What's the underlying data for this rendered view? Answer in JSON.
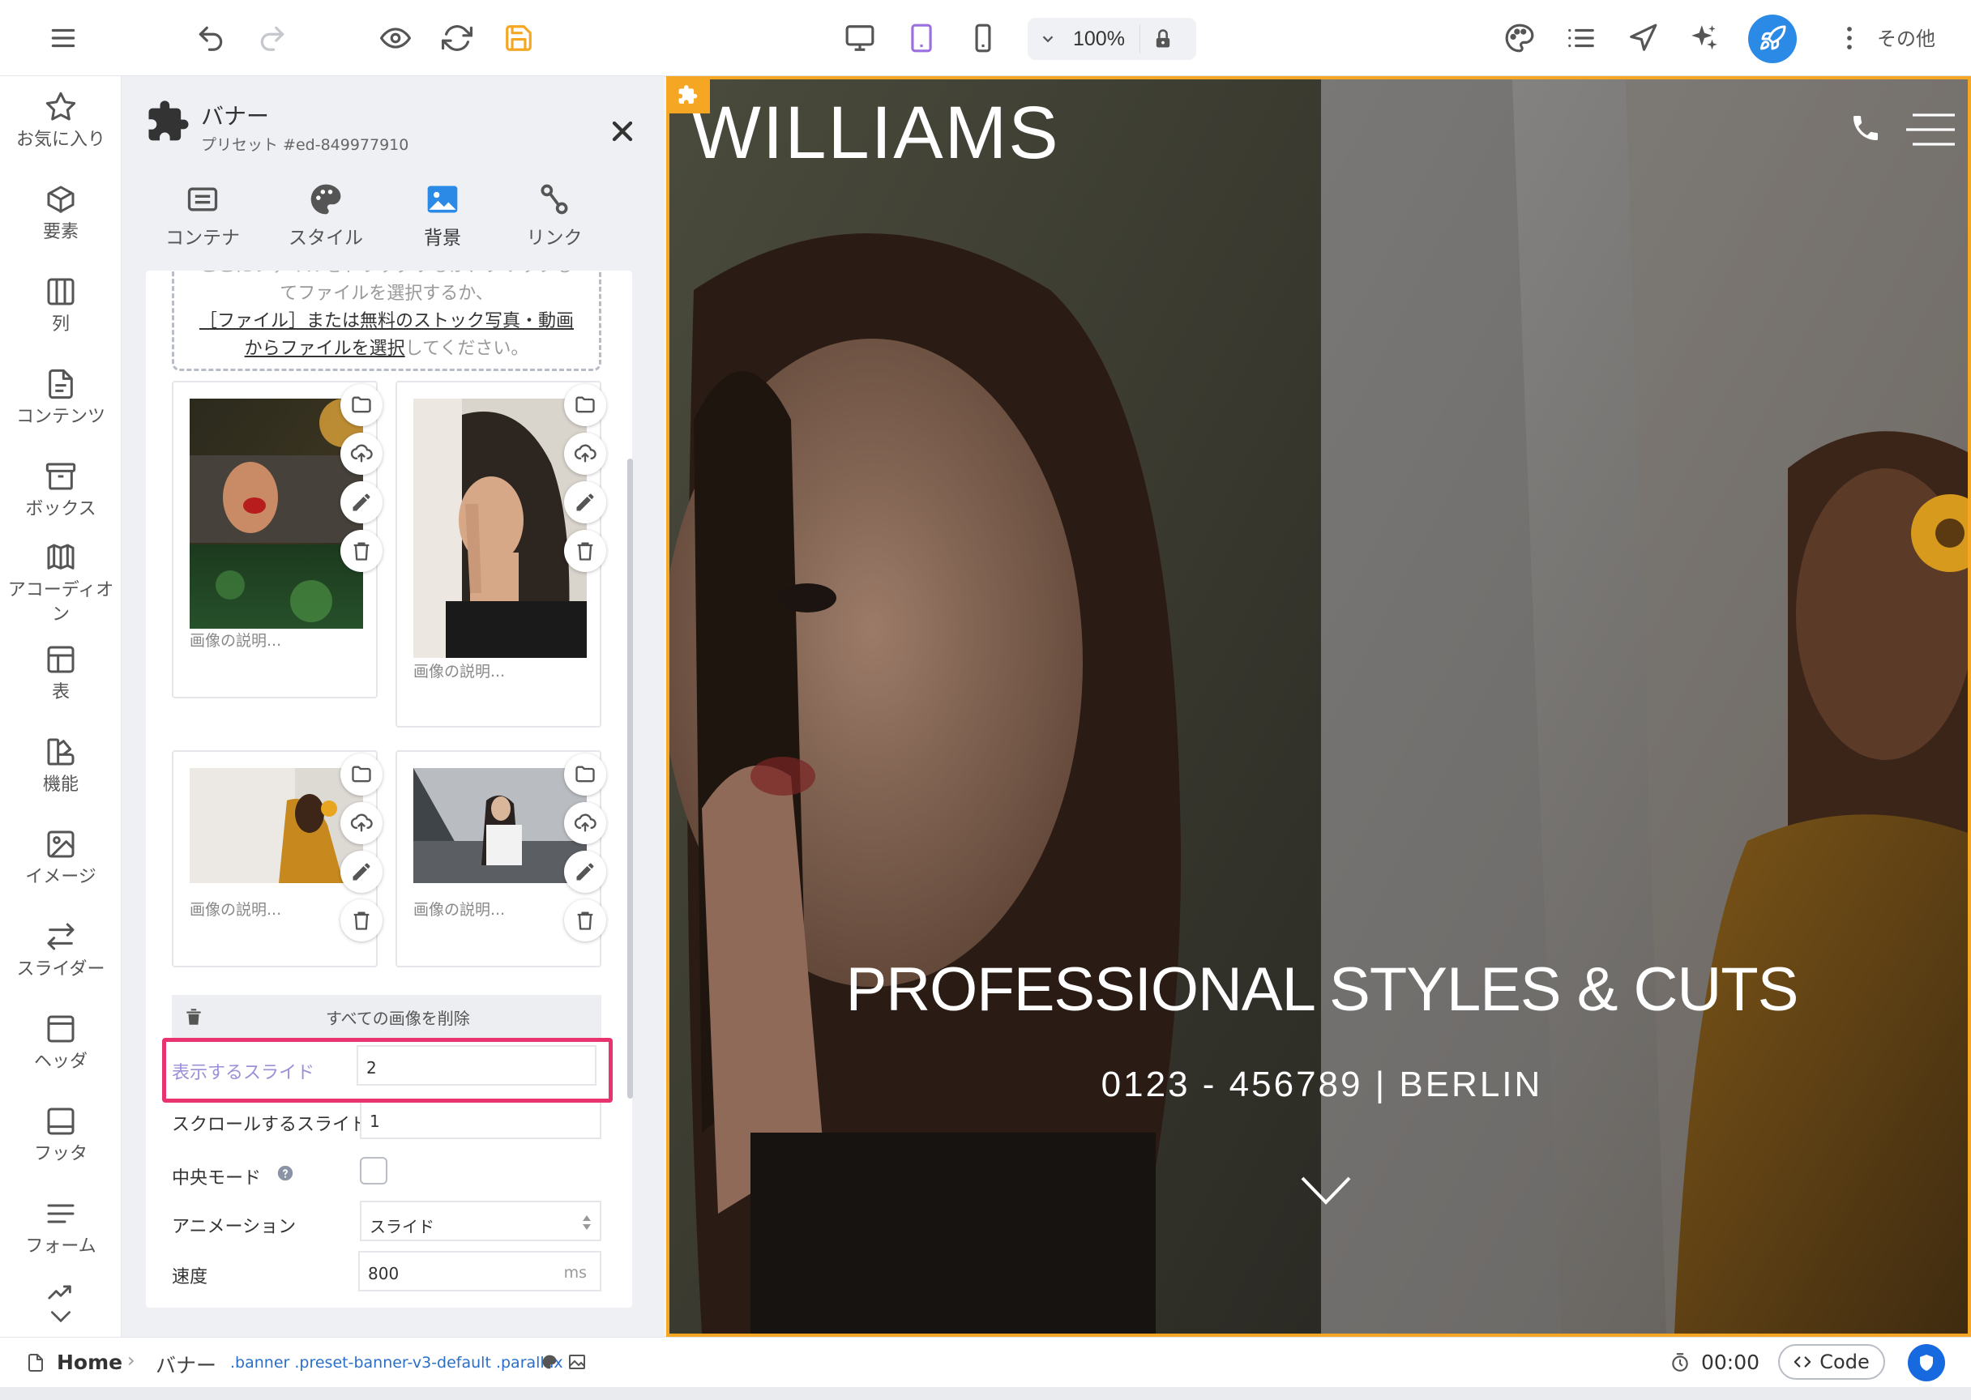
{
  "toolbar": {
    "zoom": "100%",
    "more_label": "その他",
    "accent": "#2a8ae6",
    "active_device": "tablet"
  },
  "rail": {
    "items": [
      {
        "label": "お気に入り",
        "icon": "star-icon"
      },
      {
        "label": "要素",
        "icon": "cube-icon"
      },
      {
        "label": "列",
        "icon": "columns-icon"
      },
      {
        "label": "コンテンツ",
        "icon": "document-icon"
      },
      {
        "label": "ボックス",
        "icon": "box-icon"
      },
      {
        "label": "アコーディオン",
        "icon": "accordion-icon"
      },
      {
        "label": "表",
        "icon": "table-icon"
      },
      {
        "label": "機能",
        "icon": "features-icon"
      },
      {
        "label": "イメージ",
        "icon": "image-icon"
      },
      {
        "label": "スライダー",
        "icon": "slider-arrows-icon"
      },
      {
        "label": "ヘッダ",
        "icon": "header-icon"
      },
      {
        "label": "フッタ",
        "icon": "footer-icon"
      },
      {
        "label": "フォーム",
        "icon": "form-icon"
      }
    ]
  },
  "panel": {
    "title": "バナー",
    "subtitle": "プリセット #ed-849977910",
    "tabs": [
      {
        "label": "コンテナ",
        "icon": "container-icon"
      },
      {
        "label": "スタイル",
        "icon": "palette-icon"
      },
      {
        "label": "背景",
        "icon": "image-icon",
        "active": true
      },
      {
        "label": "リンク",
        "icon": "link-icon"
      }
    ],
    "dropzone": {
      "line_top": "ここにファイルをドラッグするか、クリックし",
      "line1": "てファイルを選択するか、",
      "link1": "［ファイル］または無料のストック写真・動画",
      "link2": "からファイルを選択",
      "tail": "してください。"
    },
    "images": [
      {
        "description": "画像の説明..."
      },
      {
        "description": "画像の説明..."
      },
      {
        "description": "画像の説明..."
      },
      {
        "description": "画像の説明..."
      }
    ],
    "delete_all_label": "すべての画像を削除",
    "fields": {
      "slides_to_show": {
        "label": "表示するスライド",
        "value": "2"
      },
      "slides_to_scroll": {
        "label": "スクロールするスライド",
        "value": "1"
      },
      "center_mode": {
        "label": "中央モード"
      },
      "animation": {
        "label": "アニメーション",
        "value": "スライド"
      },
      "speed": {
        "label": "速度",
        "value": "800",
        "unit": "ms"
      }
    },
    "highlight_color": "#e8336e"
  },
  "canvas": {
    "brand": "WILLIAMS",
    "hero_title": "PROFESSIONAL STYLES & CUTS",
    "hero_subtitle": "0123 - 456789 | BERLIN",
    "frame_color": "#f5a623"
  },
  "statusbar": {
    "home": "Home",
    "crumb": "バナー",
    "classes": ".banner .preset-banner-v3-default .parallax",
    "time": "00:00",
    "code_label": "Code"
  }
}
